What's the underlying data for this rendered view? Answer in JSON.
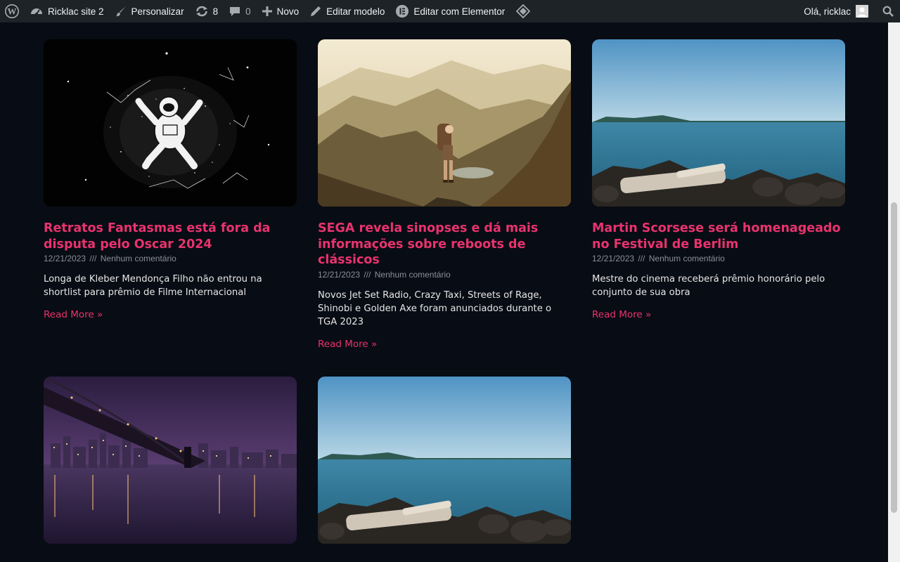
{
  "adminbar": {
    "site_name": "Ricklac site 2",
    "customize": "Personalizar",
    "updates_count": "8",
    "comments_count": "0",
    "new_label": "Novo",
    "edit_template": "Editar modelo",
    "edit_elementor": "Editar com Elementor",
    "greeting": "Olá, ricklac"
  },
  "posts": [
    {
      "title": "Retratos Fantasmas está fora da disputa pelo Oscar 2024",
      "date": "12/21/2023",
      "separator": "///",
      "comments": "Nenhum comentário",
      "excerpt": "Longa de Kleber Mendonça Filho não entrou na shortlist para prêmio de Filme Internacional",
      "read_more": "Read More »",
      "image": "astronaut-snow-angel"
    },
    {
      "title": "SEGA revela sinopses e dá mais informações sobre reboots de clássicos",
      "date": "12/21/2023",
      "separator": "///",
      "comments": "Nenhum comentário",
      "excerpt": "Novos Jet Set Radio, Crazy Taxi, Streets of Rage, Shinobi e Golden Axe foram anunciados durante o TGA 2023",
      "read_more": "Read More »",
      "image": "hiker-mountains"
    },
    {
      "title": "Martin Scorsese será homenageado no Festival de Berlim",
      "date": "12/21/2023",
      "separator": "///",
      "comments": "Nenhum comentário",
      "excerpt": "Mestre do cinema receberá prêmio honorário pelo conjunto de sua obra",
      "read_more": "Read More »",
      "image": "sea-driftwood"
    },
    {
      "title": "",
      "image": "bridge-night-city"
    },
    {
      "title": "",
      "image": "sea-driftwood"
    }
  ],
  "colors": {
    "accent": "#e8336d",
    "background": "#080c14",
    "adminbar": "#1d2327"
  }
}
